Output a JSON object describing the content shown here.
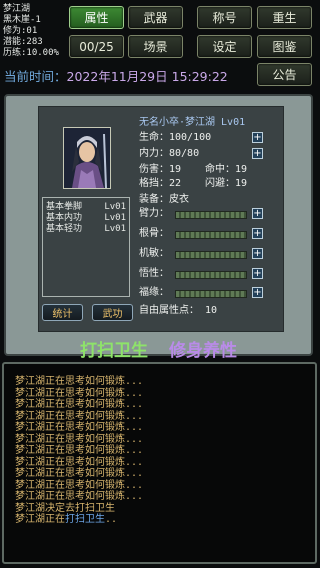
{
  "stats": {
    "name": "梦江湖",
    "location": "黑木崖-1",
    "cultivation": "修为:01",
    "potential": "潜能:283",
    "experience": "历练:10.00%"
  },
  "top_buttons": {
    "attributes": "属性",
    "martial": "武器",
    "title": "称号",
    "rebirth": "重生",
    "counter": "00/25",
    "scene": "场景",
    "settings": "设定",
    "atlas": "图鉴",
    "notice": "公告"
  },
  "clock": {
    "label": "当前时间：",
    "value": "2022年11月29日 15:29:22"
  },
  "character": {
    "name_line": "无名小卒·梦江湖  Lv01",
    "hp": "生命：100/100",
    "mp": "内力：80/80",
    "damage": "伤害：19",
    "hit": "命中：19",
    "block": "格挡：22",
    "dodge": "闪避：19",
    "equip_label": "装备：",
    "equip_value": "皮衣",
    "arm": "臂力：",
    "bone": "根骨：",
    "agility": "机敏：",
    "comprehension": "悟性：",
    "luck": "福缘：",
    "free_points": "自由属性点：  10",
    "plus": "+"
  },
  "skills": [
    {
      "name": "基本拳脚",
      "level": "Lv01"
    },
    {
      "name": "基本内功",
      "level": "Lv01"
    },
    {
      "name": "基本轻功",
      "level": "Lv01"
    }
  ],
  "panel_buttons": {
    "stats": "统计",
    "kungfu": "武功"
  },
  "slogans": {
    "left": "打扫卫生",
    "right": "修身养性"
  },
  "colors": {
    "slogan_left": "#8ee36a",
    "slogan_right": "#b98be8",
    "clock_label": "#6fa6d8"
  },
  "log": {
    "lines": [
      "梦江湖正在思考如何锻炼...",
      "梦江湖正在思考如何锻炼...",
      "梦江湖正在思考如何锻炼...",
      "梦江湖正在思考如何锻炼...",
      "梦江湖正在思考如何锻炼...",
      "梦江湖正在思考如何锻炼...",
      "梦江湖正在思考如何锻炼...",
      "梦江湖正在思考如何锻炼...",
      "梦江湖正在思考如何锻炼...",
      "梦江湖正在思考如何锻炼...",
      "梦江湖正在思考如何锻炼...",
      "梦江湖决定去打扫卫生"
    ],
    "last_prefix": "梦江湖正在",
    "last_action": "打扫卫生",
    "last_suffix": ".."
  }
}
